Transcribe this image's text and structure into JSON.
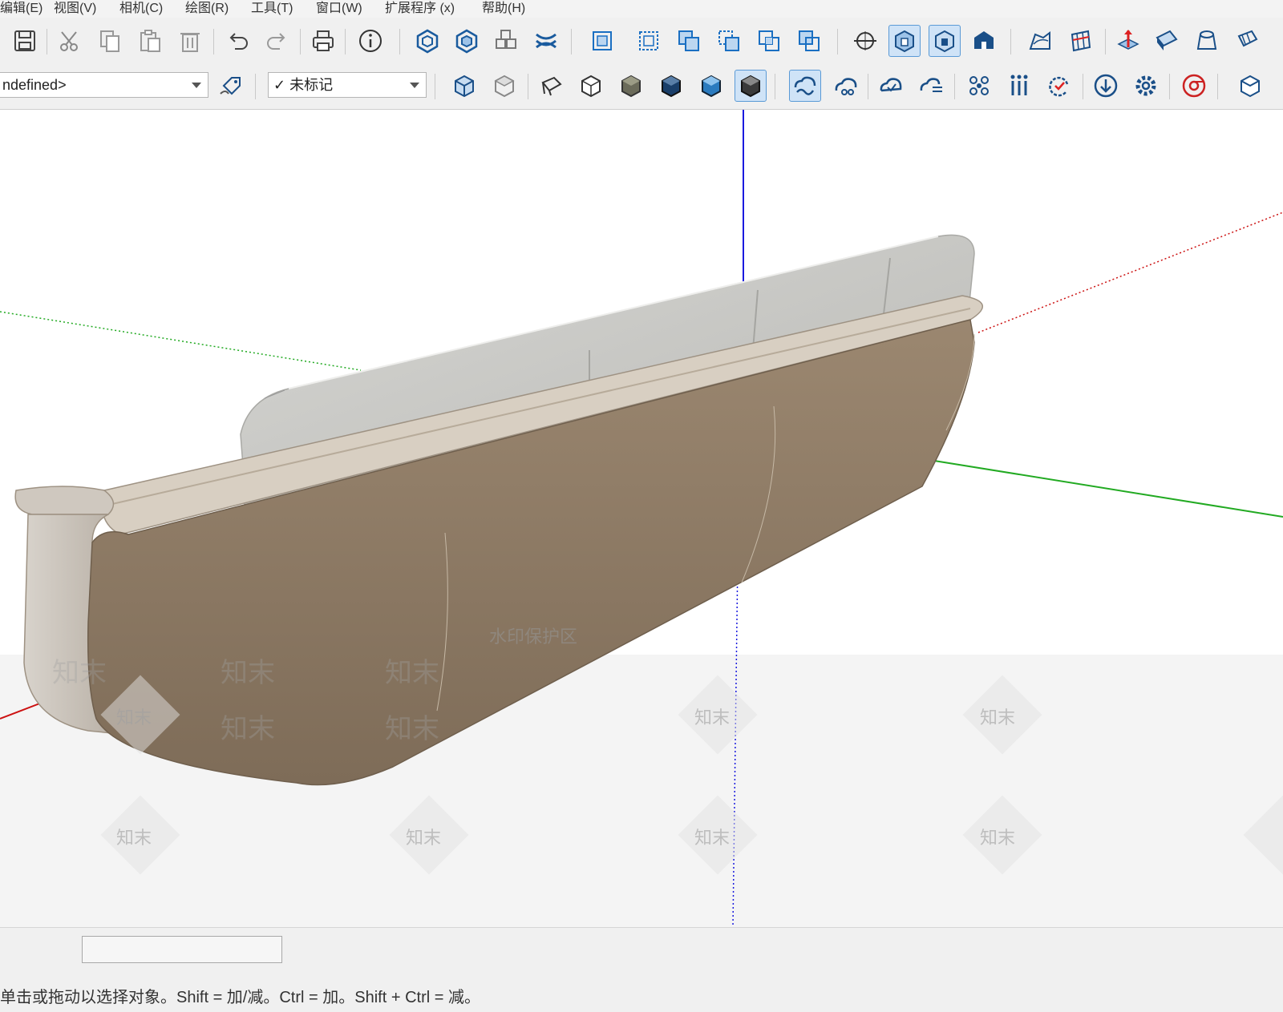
{
  "menu": {
    "items": [
      "编辑(E)",
      "视图(V)",
      "相机(C)",
      "绘图(R)",
      "工具(T)",
      "窗口(W)",
      "扩展程序 (x)",
      "帮助(H)"
    ]
  },
  "toolbar": {
    "layer_dropdown_value": "ndefined>",
    "tag_dropdown_value": "✓ 未标记"
  },
  "watermark": {
    "banner": "水印保护区",
    "brand": "知末"
  },
  "statusbar": {
    "hint": "单击或拖动以选择对象。Shift = 加/减。Ctrl = 加。Shift + Ctrl = 减。",
    "measurements_value": ""
  },
  "colors": {
    "axis_blue": "#1a1adf",
    "axis_green": "#22aa22",
    "axis_red": "#cc1111",
    "sofa_body": "#8f7c66",
    "sofa_cushion": "#c9c9c6",
    "active_button": "#cfe3f7"
  },
  "icons": {
    "toolbar1": [
      "save-icon",
      "cut-icon",
      "copy-icon",
      "paste-icon",
      "delete-icon",
      "undo-icon",
      "redo-icon",
      "print-icon",
      "model-info-icon",
      "components-in-icon",
      "components-out-icon",
      "components-icon",
      "sandbox-icon",
      "group-icon",
      "ungroup-icon",
      "union-icon",
      "subtract-icon",
      "intersect-icon",
      "trim-icon",
      "orbit-icon",
      "xray-icon",
      "back-edges-icon",
      "house-icon",
      "terrain-icon",
      "grid-icon",
      "push-pull-icon",
      "warehouse-icon",
      "extension-icon",
      "cube-frame-icon"
    ],
    "toolbar2": [
      "iso-view-icon",
      "top-view-icon",
      "front-view-icon",
      "right-view-icon",
      "back-view-icon",
      "left-view-icon",
      "bottom-view-icon",
      "shaded-view-icon",
      "cloud-sync-icon",
      "cloud-share-icon",
      "cloud-up-icon",
      "cloud-list-icon",
      "nodes-icon",
      "bars-icon",
      "refresh-icon",
      "download-icon",
      "settings-icon",
      "chrome-icon",
      "cube-outline-icon"
    ]
  }
}
